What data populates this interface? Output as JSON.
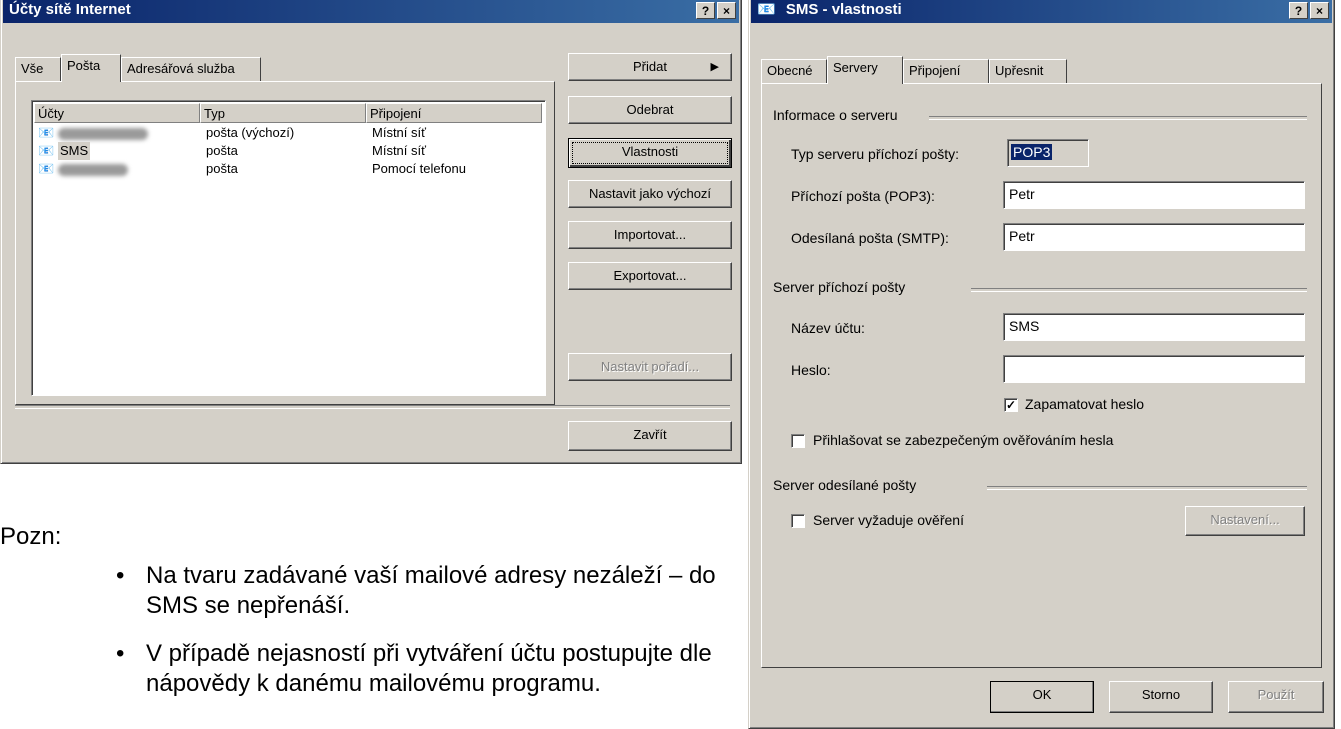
{
  "accounts_window": {
    "title": "Účty sítě Internet",
    "help_btn": "?",
    "close_btn": "×",
    "tabs": [
      {
        "label": "Vše"
      },
      {
        "label": "Pošta"
      },
      {
        "label": "Adresářová služba"
      }
    ],
    "columns": [
      "Účty",
      "Typ",
      "Připojení"
    ],
    "rows": [
      {
        "account": "",
        "type": "pošta (výchozí)",
        "connection": "Místní síť"
      },
      {
        "account": "SMS",
        "type": "pošta",
        "connection": "Místní síť"
      },
      {
        "account": "",
        "type": "pošta",
        "connection": "Pomocí telefonu"
      }
    ],
    "buttons": {
      "add": "Přidat",
      "remove": "Odebrat",
      "properties": "Vlastnosti",
      "set_default": "Nastavit jako výchozí",
      "import": "Importovat...",
      "export": "Exportovat...",
      "set_order": "Nastavit pořadí...",
      "close": "Zavřít"
    }
  },
  "props_window": {
    "title": "SMS - vlastnosti",
    "help_btn": "?",
    "close_btn": "×",
    "tabs": [
      {
        "label": "Obecné"
      },
      {
        "label": "Servery"
      },
      {
        "label": "Připojení"
      },
      {
        "label": "Upřesnit"
      }
    ],
    "server_info": {
      "group": "Informace o serveru",
      "incoming_type_label": "Typ serveru příchozí pošty:",
      "incoming_type_value": "POP3",
      "incoming_label": "Příchozí pošta (POP3):",
      "incoming_value": "Petr",
      "outgoing_label": "Odesílaná pošta (SMTP):",
      "outgoing_value": "Petr"
    },
    "incoming_server": {
      "group": "Server příchozí pošty",
      "account_label": "Název účtu:",
      "account_value": "SMS",
      "password_label": "Heslo:",
      "password_value": "",
      "remember_label": "Zapamatovat heslo",
      "remember_checked": true,
      "spa_label": "Přihlašovat se zabezpečeným ověřováním hesla",
      "spa_checked": false
    },
    "outgoing_server": {
      "group": "Server odesílané pošty",
      "auth_label": "Server vyžaduje ověření",
      "auth_checked": false,
      "settings_btn": "Nastavení..."
    },
    "buttons": {
      "ok": "OK",
      "cancel": "Storno",
      "apply": "Použít"
    }
  },
  "note": {
    "heading": "Pozn:",
    "bullets": [
      "Na tvaru zadávané vaší mailové adresy nezáleží – do SMS se nepřenáší.",
      "V případě nejasností při vytváření účtu postupujte dle nápovědy k danému mailovému programu."
    ]
  }
}
